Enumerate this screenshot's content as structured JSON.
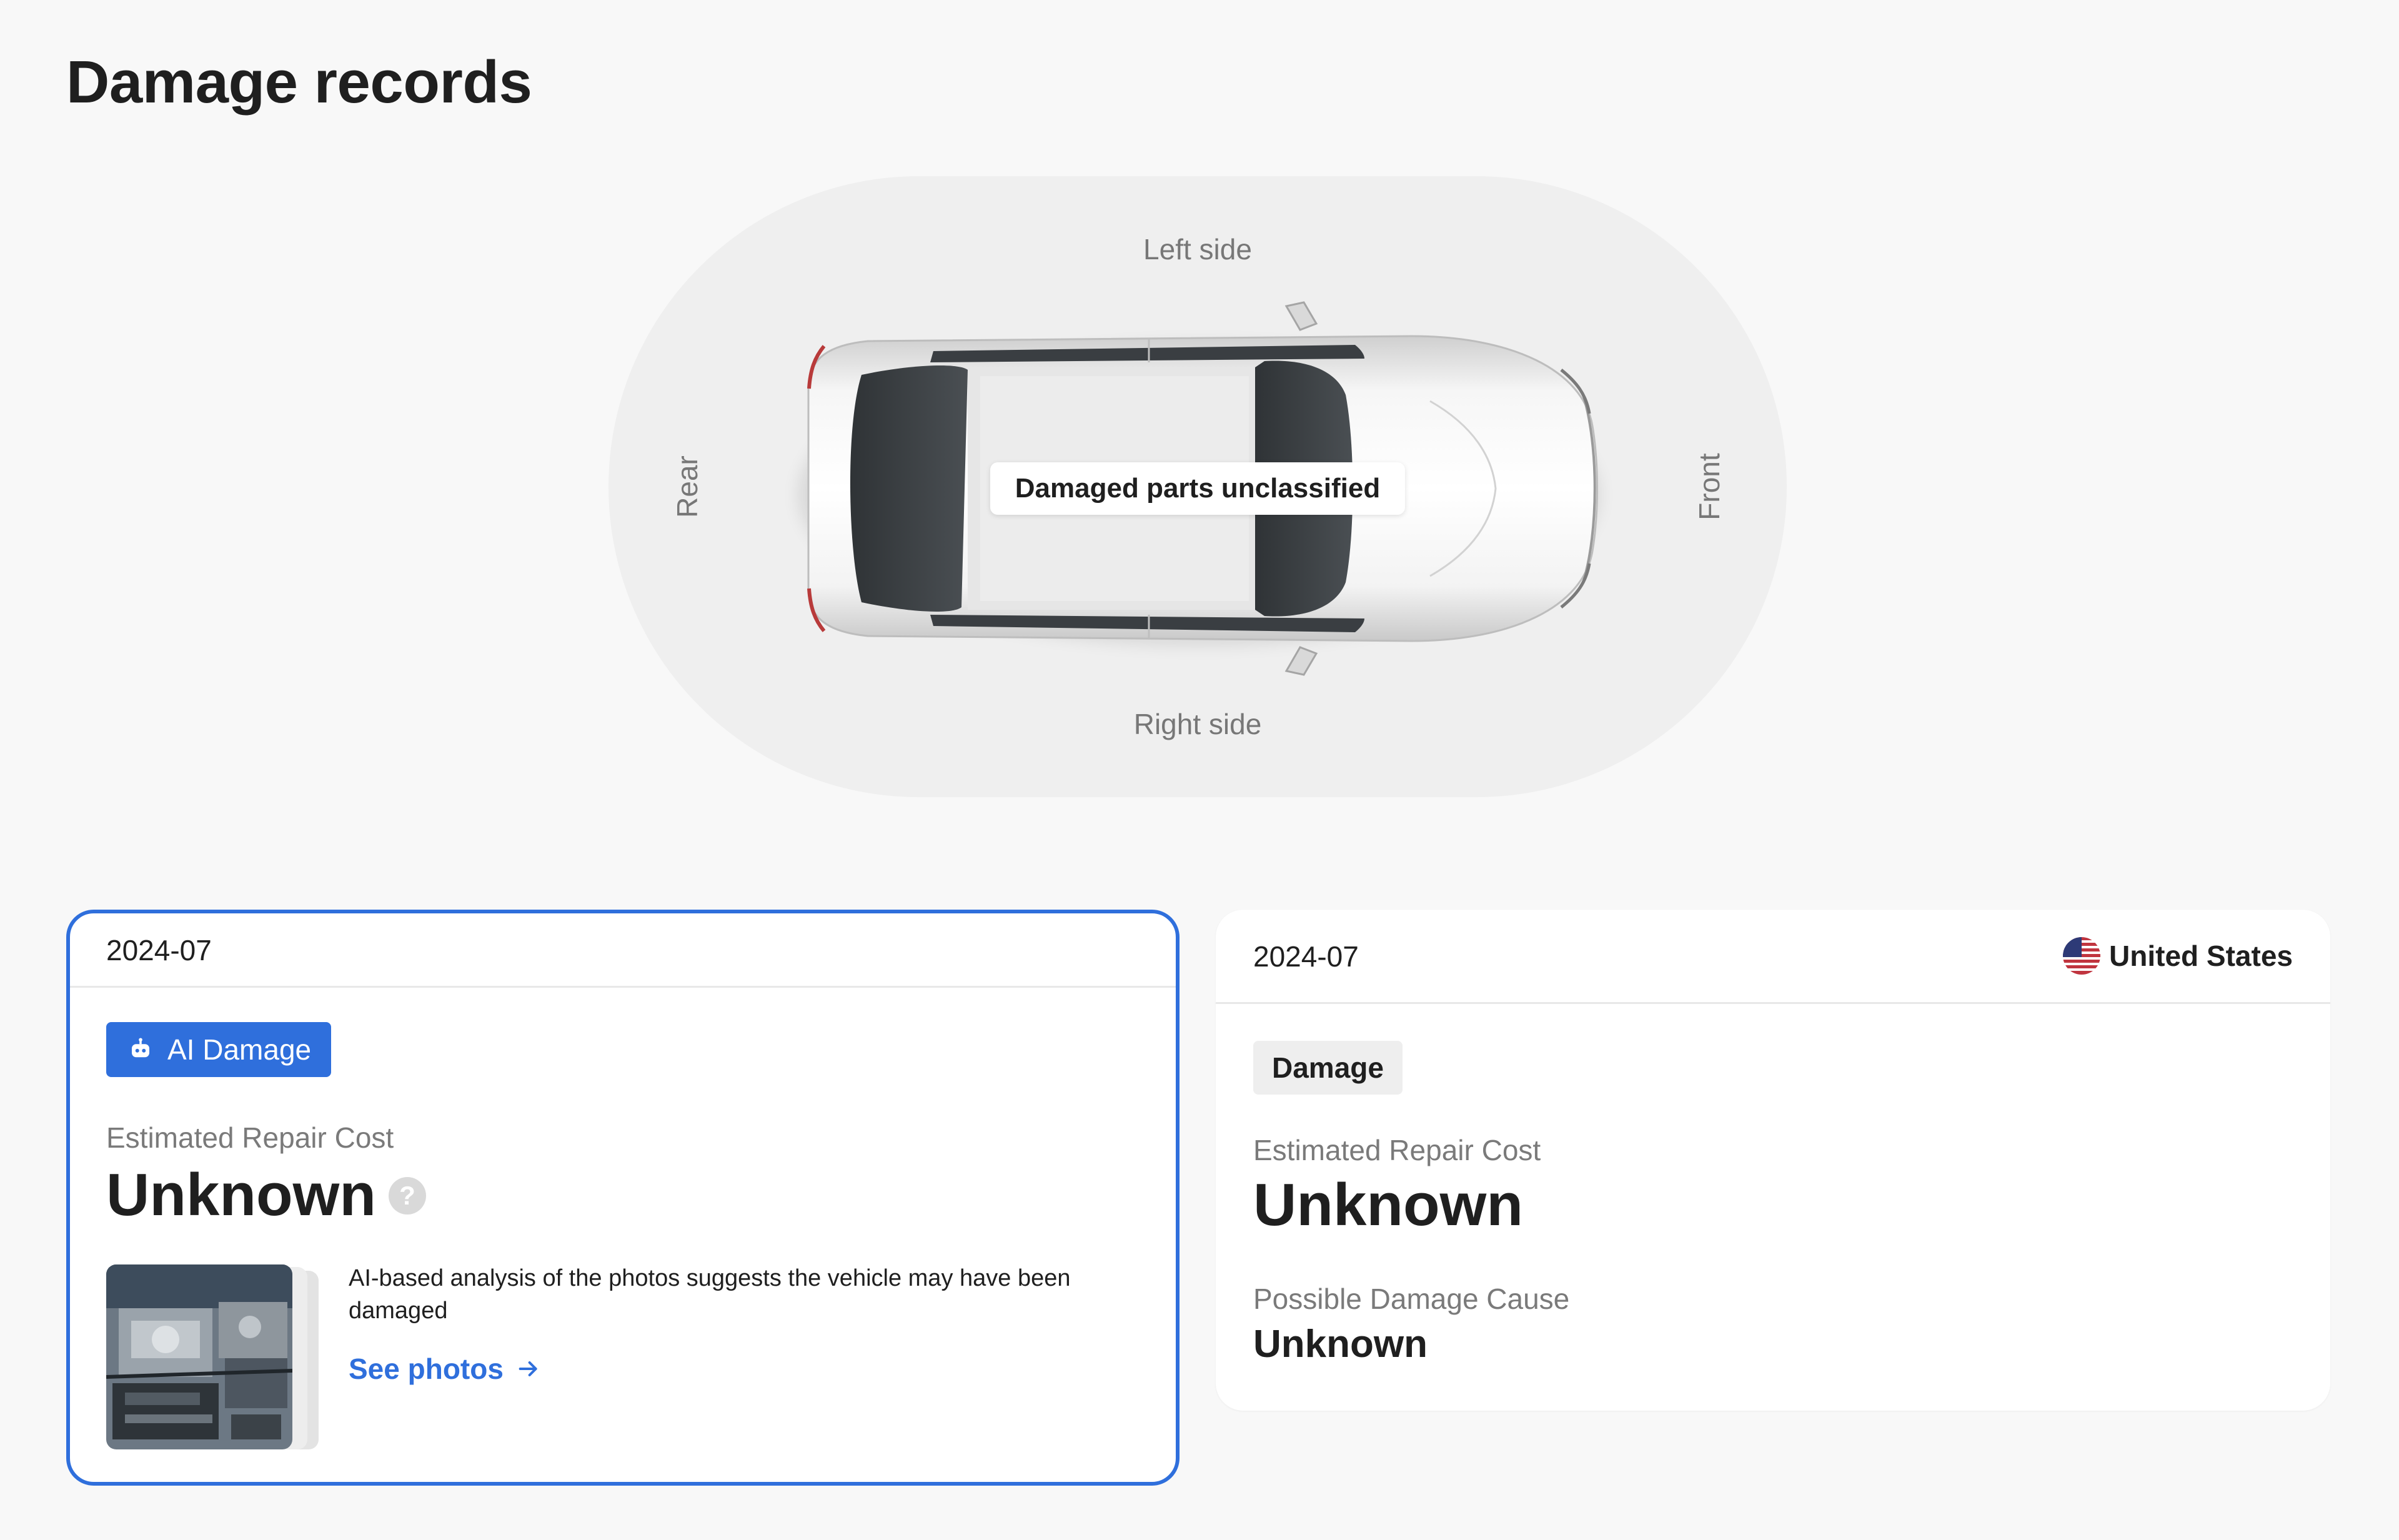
{
  "page": {
    "title": "Damage records"
  },
  "diagram": {
    "left_side": "Left side",
    "right_side": "Right side",
    "rear": "Rear",
    "front": "Front",
    "damage_label": "Damaged parts unclassified"
  },
  "cards": [
    {
      "date": "2024-07",
      "badge": "AI Damage",
      "badge_icon": "robot-icon",
      "repair_cost_label": "Estimated Repair Cost",
      "repair_cost_value": "Unknown",
      "help_icon": "?",
      "description": "AI-based analysis of the photos suggests the vehicle may have been damaged",
      "link_label": "See photos",
      "selected": true
    },
    {
      "date": "2024-07",
      "country": "United States",
      "badge": "Damage",
      "repair_cost_label": "Estimated Repair Cost",
      "repair_cost_value": "Unknown",
      "cause_label": "Possible Damage Cause",
      "cause_value": "Unknown"
    }
  ],
  "colors": {
    "accent": "#2f6fdc",
    "background": "#f8f8f8",
    "diagram_bg": "#efefef"
  }
}
